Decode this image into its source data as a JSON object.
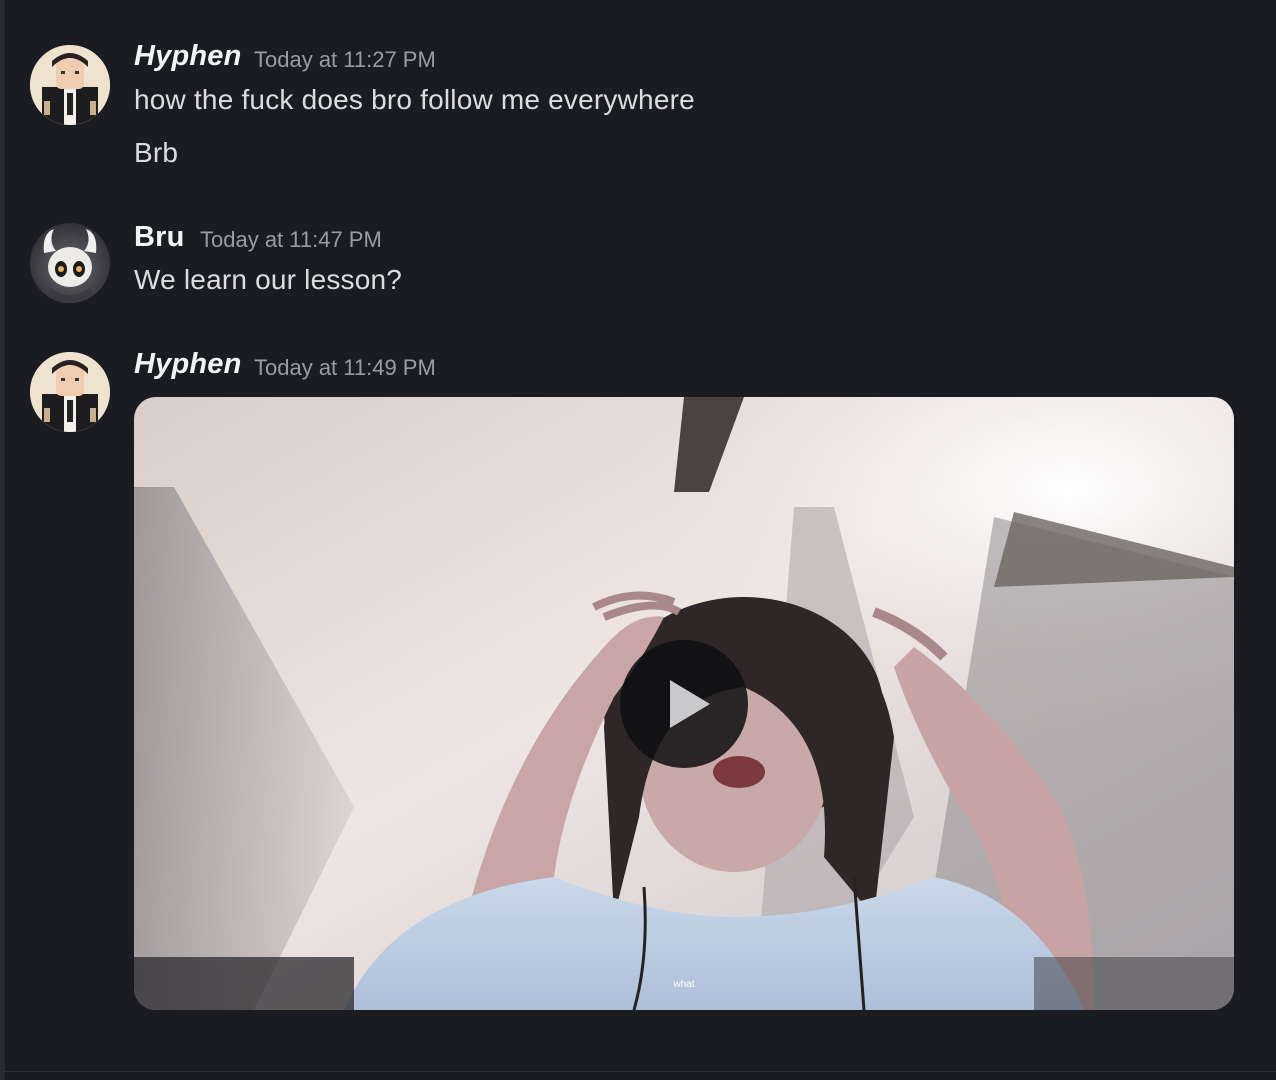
{
  "messages": [
    {
      "author": "Hyphen",
      "timestamp": "Today at 11:27 PM",
      "lines": [
        "how the fuck does bro follow me everywhere",
        "Brb"
      ]
    },
    {
      "author": "Bru",
      "timestamp": "Today at 11:47 PM",
      "lines": [
        "We learn our lesson?"
      ]
    },
    {
      "author": "Hyphen",
      "timestamp": "Today at 11:49 PM",
      "attachment": {
        "type": "video",
        "caption": "what",
        "control": "play-icon"
      }
    }
  ],
  "colors": {
    "background": "#1b1c21",
    "username": "#f2f3f5",
    "timestamp": "#9a9ca4",
    "message_text": "#dcdde1",
    "play_button": "#0e0e10"
  }
}
